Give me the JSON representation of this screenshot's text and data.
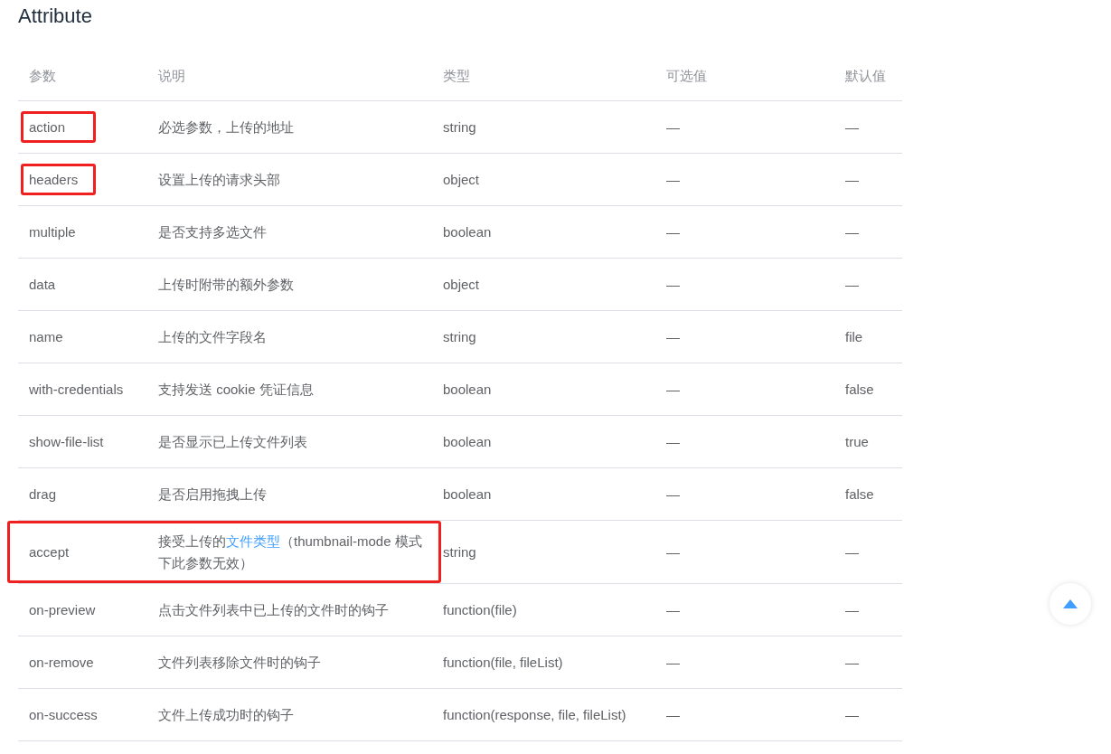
{
  "title": "Attribute",
  "table": {
    "columns": [
      "参数",
      "说明",
      "类型",
      "可选值",
      "默认值"
    ],
    "rows": [
      {
        "boxed": true,
        "boxed_wide": false,
        "cells": [
          [
            {
              "kind": "text",
              "text": "action"
            }
          ],
          [
            {
              "kind": "text",
              "text": "必选参数，上传的地址"
            }
          ],
          [
            {
              "kind": "text",
              "text": "string"
            }
          ],
          [
            {
              "kind": "text",
              "text": "—"
            }
          ],
          [
            {
              "kind": "text",
              "text": "—"
            }
          ]
        ]
      },
      {
        "boxed": true,
        "boxed_wide": false,
        "cells": [
          [
            {
              "kind": "text",
              "text": "headers"
            }
          ],
          [
            {
              "kind": "text",
              "text": "设置上传的请求头部"
            }
          ],
          [
            {
              "kind": "text",
              "text": "object"
            }
          ],
          [
            {
              "kind": "text",
              "text": "—"
            }
          ],
          [
            {
              "kind": "text",
              "text": "—"
            }
          ]
        ]
      },
      {
        "boxed": false,
        "boxed_wide": false,
        "cells": [
          [
            {
              "kind": "text",
              "text": "multiple"
            }
          ],
          [
            {
              "kind": "text",
              "text": "是否支持多选文件"
            }
          ],
          [
            {
              "kind": "text",
              "text": "boolean"
            }
          ],
          [
            {
              "kind": "text",
              "text": "—"
            }
          ],
          [
            {
              "kind": "text",
              "text": "—"
            }
          ]
        ]
      },
      {
        "boxed": false,
        "boxed_wide": false,
        "cells": [
          [
            {
              "kind": "text",
              "text": "data"
            }
          ],
          [
            {
              "kind": "text",
              "text": "上传时附带的额外参数"
            }
          ],
          [
            {
              "kind": "text",
              "text": "object"
            }
          ],
          [
            {
              "kind": "text",
              "text": "—"
            }
          ],
          [
            {
              "kind": "text",
              "text": "—"
            }
          ]
        ]
      },
      {
        "boxed": false,
        "boxed_wide": false,
        "cells": [
          [
            {
              "kind": "text",
              "text": "name"
            }
          ],
          [
            {
              "kind": "text",
              "text": "上传的文件字段名"
            }
          ],
          [
            {
              "kind": "text",
              "text": "string"
            }
          ],
          [
            {
              "kind": "text",
              "text": "—"
            }
          ],
          [
            {
              "kind": "text",
              "text": "file"
            }
          ]
        ]
      },
      {
        "boxed": false,
        "boxed_wide": false,
        "cells": [
          [
            {
              "kind": "text",
              "text": "with-credentials"
            }
          ],
          [
            {
              "kind": "text",
              "text": "支持发送 cookie 凭证信息"
            }
          ],
          [
            {
              "kind": "text",
              "text": "boolean"
            }
          ],
          [
            {
              "kind": "text",
              "text": "—"
            }
          ],
          [
            {
              "kind": "text",
              "text": "false"
            }
          ]
        ]
      },
      {
        "boxed": false,
        "boxed_wide": false,
        "cells": [
          [
            {
              "kind": "text",
              "text": "show-file-list"
            }
          ],
          [
            {
              "kind": "text",
              "text": "是否显示已上传文件列表"
            }
          ],
          [
            {
              "kind": "text",
              "text": "boolean"
            }
          ],
          [
            {
              "kind": "text",
              "text": "—"
            }
          ],
          [
            {
              "kind": "text",
              "text": "true"
            }
          ]
        ]
      },
      {
        "boxed": false,
        "boxed_wide": false,
        "cells": [
          [
            {
              "kind": "text",
              "text": "drag"
            }
          ],
          [
            {
              "kind": "text",
              "text": "是否启用拖拽上传"
            }
          ],
          [
            {
              "kind": "text",
              "text": "boolean"
            }
          ],
          [
            {
              "kind": "text",
              "text": "—"
            }
          ],
          [
            {
              "kind": "text",
              "text": "false"
            }
          ]
        ]
      },
      {
        "boxed": true,
        "boxed_wide": true,
        "cells": [
          [
            {
              "kind": "text",
              "text": "accept"
            }
          ],
          [
            {
              "kind": "text",
              "text": "接受上传的"
            },
            {
              "kind": "link",
              "text": "文件类型"
            },
            {
              "kind": "text",
              "text": "（thumbnail-mode 模式下此参数无效）"
            }
          ],
          [
            {
              "kind": "text",
              "text": "string"
            }
          ],
          [
            {
              "kind": "text",
              "text": "—"
            }
          ],
          [
            {
              "kind": "text",
              "text": "—"
            }
          ]
        ]
      },
      {
        "boxed": false,
        "boxed_wide": false,
        "cells": [
          [
            {
              "kind": "text",
              "text": "on-preview"
            }
          ],
          [
            {
              "kind": "text",
              "text": "点击文件列表中已上传的文件时的钩子"
            }
          ],
          [
            {
              "kind": "text",
              "text": "function(file)"
            }
          ],
          [
            {
              "kind": "text",
              "text": "—"
            }
          ],
          [
            {
              "kind": "text",
              "text": "—"
            }
          ]
        ]
      },
      {
        "boxed": false,
        "boxed_wide": false,
        "cells": [
          [
            {
              "kind": "text",
              "text": "on-remove"
            }
          ],
          [
            {
              "kind": "text",
              "text": "文件列表移除文件时的钩子"
            }
          ],
          [
            {
              "kind": "text",
              "text": "function(file, fileList)"
            }
          ],
          [
            {
              "kind": "text",
              "text": "—"
            }
          ],
          [
            {
              "kind": "text",
              "text": "—"
            }
          ]
        ]
      },
      {
        "boxed": false,
        "boxed_wide": false,
        "cells": [
          [
            {
              "kind": "text",
              "text": "on-success"
            }
          ],
          [
            {
              "kind": "text",
              "text": "文件上传成功时的钩子"
            }
          ],
          [
            {
              "kind": "text",
              "text": "function(response, file, fileList)"
            }
          ],
          [
            {
              "kind": "text",
              "text": "—"
            }
          ],
          [
            {
              "kind": "text",
              "text": "—"
            }
          ]
        ]
      }
    ]
  }
}
